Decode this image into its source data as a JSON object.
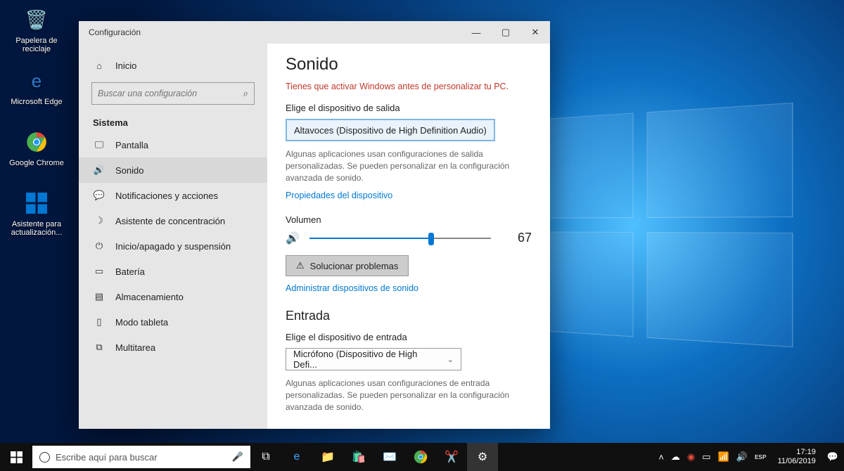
{
  "desktop": {
    "recycle": "Papelera de reciclaje",
    "edge": "Microsoft Edge",
    "chrome": "Google Chrome",
    "assistant": "Asistente para actualización..."
  },
  "window": {
    "title": "Configuración"
  },
  "sidebar": {
    "home": "Inicio",
    "search_placeholder": "Buscar una configuración",
    "category": "Sistema",
    "items": [
      {
        "label": "Pantalla"
      },
      {
        "label": "Sonido"
      },
      {
        "label": "Notificaciones y acciones"
      },
      {
        "label": "Asistente de concentración"
      },
      {
        "label": "Inicio/apagado y suspensión"
      },
      {
        "label": "Batería"
      },
      {
        "label": "Almacenamiento"
      },
      {
        "label": "Modo tableta"
      },
      {
        "label": "Multitarea"
      }
    ]
  },
  "main": {
    "heading": "Sonido",
    "activation_warning": "Tienes que activar Windows antes de personalizar tu PC.",
    "output_label": "Elige el dispositivo de salida",
    "output_device": "Altavoces (Dispositivo de High Definition Audio)",
    "output_hint": "Algunas aplicaciones usan configuraciones de salida personalizadas. Se pueden personalizar en la configuración avanzada de sonido.",
    "device_props_link": "Propiedades del dispositivo",
    "volume_label": "Volumen",
    "volume_value": "67",
    "volume_percent": 67,
    "troubleshoot": "Solucionar problemas",
    "manage_link": "Administrar dispositivos de sonido",
    "input_heading": "Entrada",
    "input_label": "Elige el dispositivo de entrada",
    "input_device": "Micrófono (Dispositivo de High Defi...",
    "input_hint": "Algunas aplicaciones usan configuraciones de entrada personalizadas. Se pueden personalizar en la configuración avanzada de sonido."
  },
  "taskbar": {
    "search_placeholder": "Escribe aquí para buscar",
    "time": "17:19",
    "date": "11/06/2019"
  }
}
